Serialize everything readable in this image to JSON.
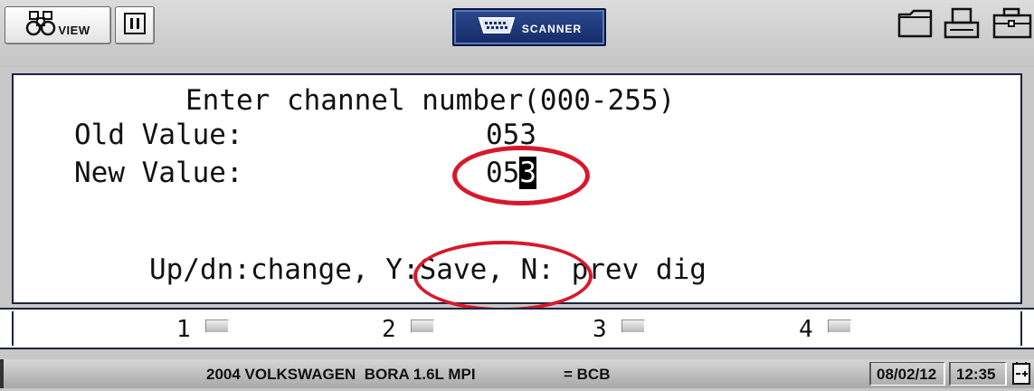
{
  "toolbar": {
    "view_label": "VIEW",
    "scanner_label": "SCANNER",
    "icons": [
      "binoculars-icon",
      "pause-icon",
      "obd-connector-icon",
      "folder-icon",
      "printer-icon",
      "toolbox-icon"
    ]
  },
  "screen": {
    "prompt": "Enter channel number(000-255)",
    "old_value_label": "Old Value:",
    "old_value": "053",
    "new_value_label": "New Value:",
    "new_value_prefix": "05",
    "new_value_cursor": "3",
    "hint_part1": "Up/dn:change, ",
    "hint_save": "Y:Save,",
    "hint_part2": " N: prev dig",
    "highlight_color": "#d8182a"
  },
  "softkeys": [
    {
      "label": "1"
    },
    {
      "label": "2"
    },
    {
      "label": "3"
    },
    {
      "label": "4"
    }
  ],
  "status": {
    "vehicle": "2004 VOLKSWAGEN  BORA 1.6L MPI",
    "code": "= BCB",
    "date": "08/02/12",
    "time": "12:35"
  }
}
